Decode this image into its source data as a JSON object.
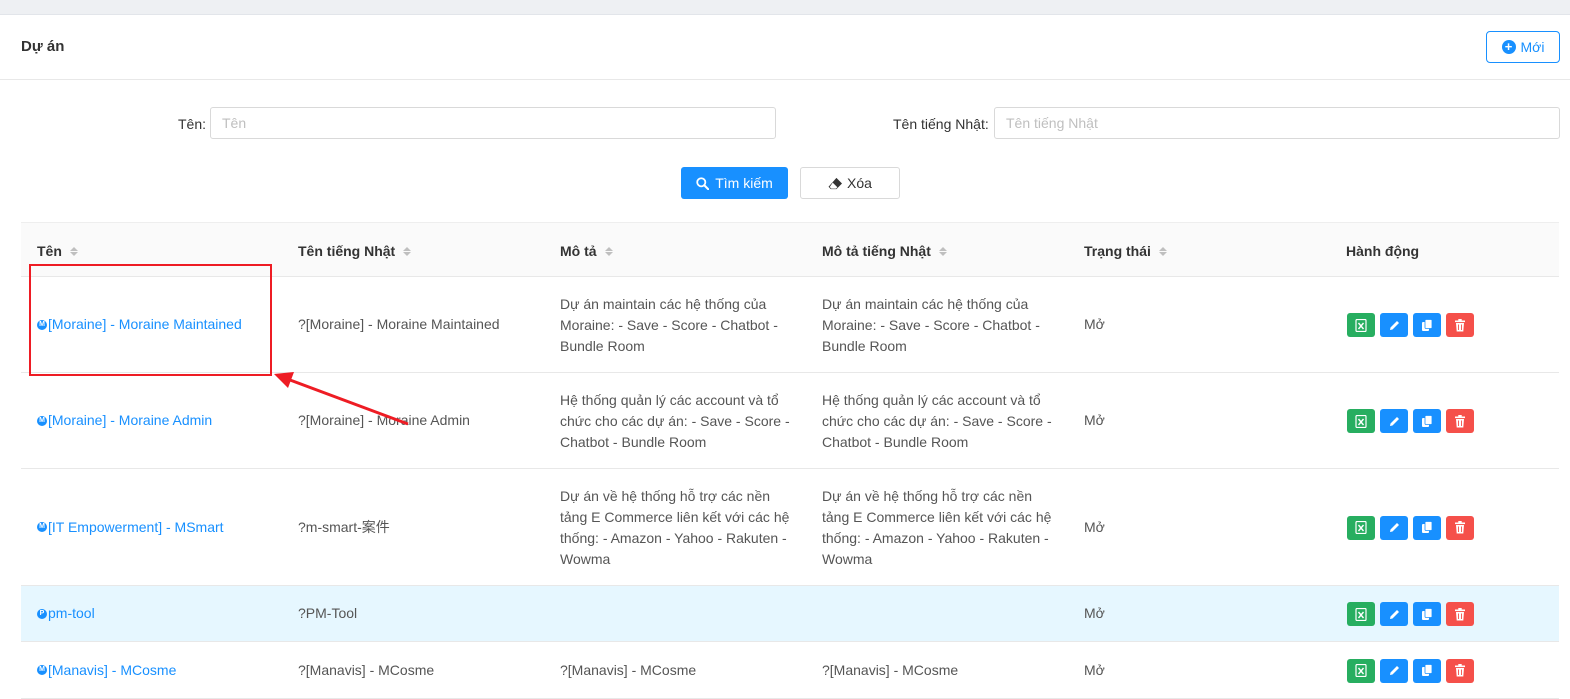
{
  "header": {
    "title": "Dự án",
    "new_button": "Mới"
  },
  "filters": {
    "name_label": "Tên:",
    "name_placeholder": "Tên",
    "name_value": "",
    "jp_label": "Tên tiếng Nhật:",
    "jp_placeholder": "Tên tiếng Nhật",
    "jp_value": "",
    "search_button": "Tìm kiếm",
    "clear_button": "Xóa"
  },
  "table": {
    "columns": [
      "Tên",
      "Tên tiếng Nhật",
      "Mô tả",
      "Mô tả tiếng Nhật",
      "Trạng thái",
      "Hành động"
    ],
    "rows": [
      {
        "avatar": "M",
        "name": "[Moraine] - Moraine Maintained",
        "jp_name": "?[Moraine] - Moraine Maintained",
        "desc": "Dự án maintain các hệ thống của Moraine: - Save - Score - Chatbot - Bundle Room",
        "jp_desc": "Dự án maintain các hệ thống của Moraine: - Save - Score - Chatbot - Bundle Room",
        "status": "Mở"
      },
      {
        "avatar": "M",
        "name": "[Moraine] - Moraine Admin",
        "jp_name": "?[Moraine] - Moraine Admin",
        "desc": "Hệ thống quản lý các account và tổ chức cho các dự án: - Save - Score - Chatbot - Bundle Room",
        "jp_desc": "Hệ thống quản lý các account và tổ chức cho các dự án: - Save - Score - Chatbot - Bundle Room",
        "status": "Mở"
      },
      {
        "avatar": "M",
        "name": "[IT Empowerment] - MSmart",
        "jp_name": "?m-smart-案件",
        "desc": "Dự án về hệ thống hỗ trợ các nền tảng E Commerce liên kết với các hệ thống: - Amazon - Yahoo - Rakuten - Wowma",
        "jp_desc": "Dự án về hệ thống hỗ trợ các nền tảng E Commerce liên kết với các hệ thống: - Amazon - Yahoo - Rakuten - Wowma",
        "status": "Mở"
      },
      {
        "avatar": "P",
        "name": "pm-tool",
        "jp_name": "?PM-Tool",
        "desc": "",
        "jp_desc": "",
        "status": "Mở"
      },
      {
        "avatar": "M",
        "name": "[Manavis] - MCosme",
        "jp_name": "?[Manavis] - MCosme",
        "desc": "?[Manavis] - MCosme",
        "jp_desc": "?[Manavis] - MCosme",
        "status": "Mở"
      }
    ]
  },
  "colors": {
    "primary": "#1890ff",
    "excel": "#27ae60",
    "danger": "#f5504a",
    "annotation": "#ee1c24",
    "highlight_row": "#e6f7ff"
  },
  "icons": {
    "new": "plus-circle-icon",
    "search": "search-icon",
    "clear": "eraser-icon",
    "actions": [
      "excel-icon",
      "edit-icon",
      "copy-icon",
      "delete-icon"
    ]
  }
}
